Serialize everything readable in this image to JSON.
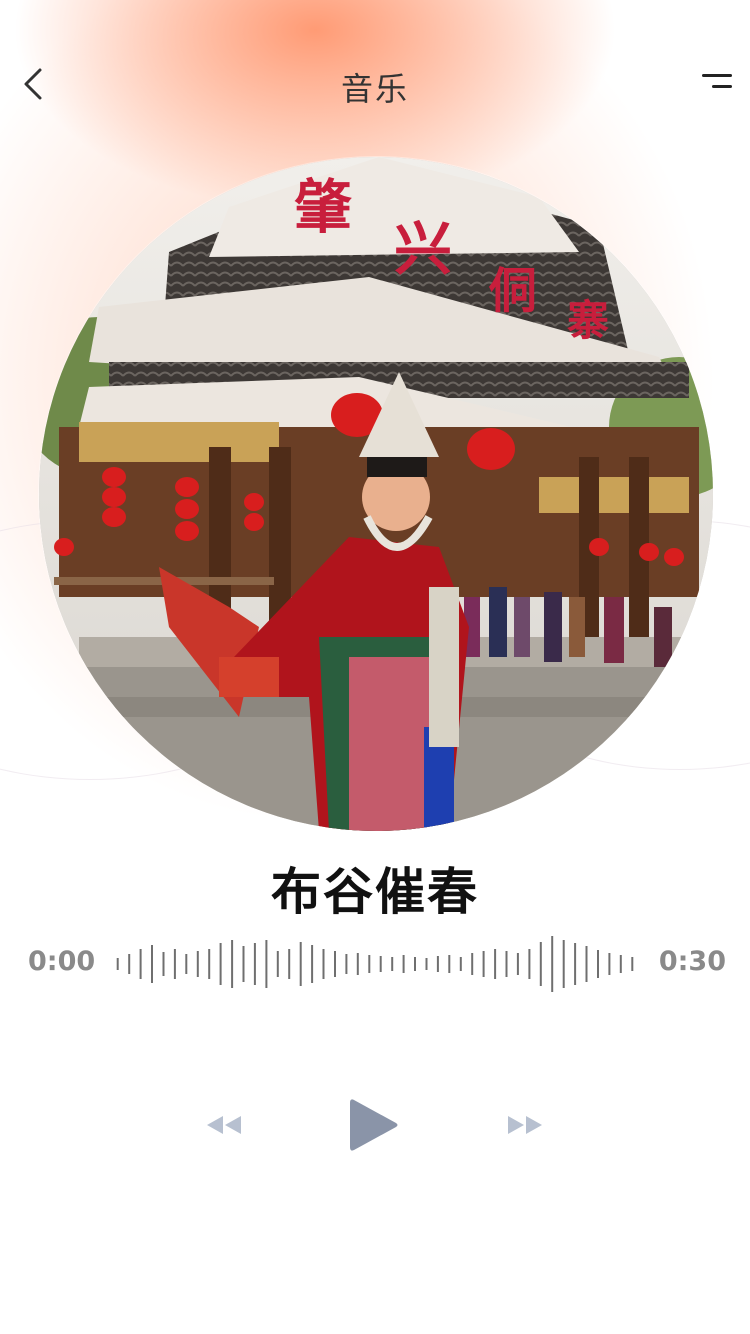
{
  "header": {
    "title": "音乐",
    "back_icon": "chevron-left-icon",
    "menu_icon": "menu-icon"
  },
  "cover": {
    "image": "album-cover-dong-village-dancer",
    "sign_text": "肇兴侗寨"
  },
  "song": {
    "title": "布谷催春"
  },
  "progress": {
    "current": "0:00",
    "total": "0:30",
    "fraction": 0
  },
  "controls": {
    "prev_icon": "rewind-icon",
    "play_icon": "play-icon",
    "next_icon": "fast-forward-icon"
  },
  "colors": {
    "accent_glow": "#ff9a72",
    "control": "#8a94a8",
    "control_light": "#b7c0d0",
    "text_dark": "#111111",
    "text_muted": "#8a8a8a"
  }
}
